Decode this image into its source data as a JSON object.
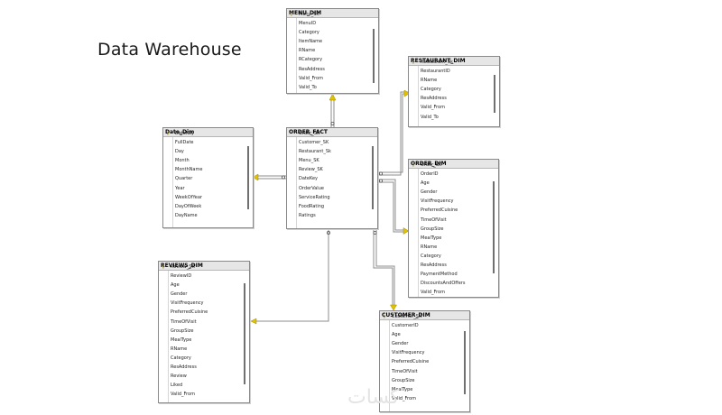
{
  "title": "Data Warehouse",
  "watermark": "كسات",
  "tables": [
    {
      "name": "MENU_DIM",
      "key": "menu",
      "fields": [
        "Menu_SK",
        "MenuID",
        "Category",
        "ItemName",
        "RName",
        "RCategory",
        "ResAddress",
        "Valid_From",
        "Valid_To"
      ],
      "key_fields": [
        0
      ]
    },
    {
      "name": "RESTAURANT_DIM",
      "key": "restaurant",
      "fields": [
        "Restaurant_Sk",
        "RestaurantID",
        "RName",
        "Category",
        "ResAddress",
        "Valid_From",
        "Valid_To"
      ],
      "key_fields": [
        0
      ]
    },
    {
      "name": "Date_Dim",
      "key": "date",
      "fields": [
        "DateKey",
        "FullDate",
        "Day",
        "Month",
        "MonthName",
        "Quarter",
        "Year",
        "WeekOfYear",
        "DayOfWeek",
        "DayName"
      ],
      "key_fields": [
        0
      ]
    },
    {
      "name": "ORDER_FACT",
      "key": "orderfact",
      "fields": [
        "Order_SK",
        "Customer_SK",
        "Restaurant_Sk",
        "Menu_SK",
        "Review_SK",
        "DateKey",
        "OrderValue",
        "ServiceRating",
        "FoodRating",
        "Ratings"
      ],
      "key_fields": []
    },
    {
      "name": "ORDER_DIM",
      "key": "orderdim",
      "fields": [
        "Order_SK",
        "OrderID",
        "Age",
        "Gender",
        "VisitFrequency",
        "PreferredCuisine",
        "TimeOfVisit",
        "GroupSize",
        "MealType",
        "RName",
        "Category",
        "ResAddress",
        "PaymentMethod",
        "DiscountsAndOffers",
        "Valid_From"
      ],
      "key_fields": [
        0
      ]
    },
    {
      "name": "REVIEWS_DIM",
      "key": "reviews",
      "fields": [
        "Review_SK",
        "ReviewID",
        "Age",
        "Gender",
        "VisitFrequency",
        "PreferredCuisine",
        "TimeOfVisit",
        "GroupSize",
        "MealType",
        "RName",
        "Category",
        "ResAddress",
        "Review",
        "Liked",
        "Valid_From"
      ],
      "key_fields": [
        0
      ]
    },
    {
      "name": "CUSTOMER_DIM",
      "key": "customer",
      "fields": [
        "Customer_SK",
        "CustomerID",
        "Age",
        "Gender",
        "VisitFrequency",
        "PreferredCuisine",
        "TimeOfVisit",
        "GroupSize",
        "MealType",
        "Valid_From"
      ],
      "key_fields": [
        0
      ]
    }
  ],
  "relationships": [
    {
      "from": "ORDER_FACT",
      "to": "MENU_DIM"
    },
    {
      "from": "ORDER_FACT",
      "to": "RESTAURANT_DIM"
    },
    {
      "from": "ORDER_FACT",
      "to": "Date_Dim"
    },
    {
      "from": "ORDER_FACT",
      "to": "ORDER_DIM"
    },
    {
      "from": "ORDER_FACT",
      "to": "REVIEWS_DIM"
    },
    {
      "from": "ORDER_FACT",
      "to": "CUSTOMER_DIM"
    }
  ],
  "colors": {
    "line": "#8c8c8c",
    "arrow": "#e0c200",
    "border": "#8a8a8a",
    "header_bg": "#e6e6e6"
  }
}
